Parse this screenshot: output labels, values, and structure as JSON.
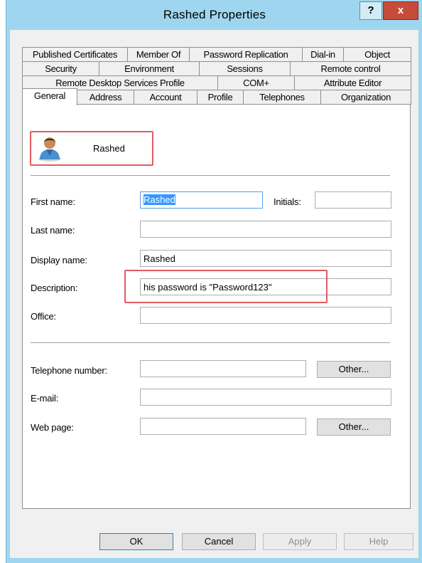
{
  "window": {
    "title": "Rashed Properties",
    "help_label": "?",
    "close_label": "x"
  },
  "tabs": {
    "row1": [
      "Published Certificates",
      "Member Of",
      "Password Replication",
      "Dial-in",
      "Object"
    ],
    "row2": [
      "Security",
      "Environment",
      "Sessions",
      "Remote control"
    ],
    "row3": [
      "Remote Desktop Services Profile",
      "COM+",
      "Attribute Editor"
    ],
    "row4": [
      "General",
      "Address",
      "Account",
      "Profile",
      "Telephones",
      "Organization"
    ],
    "active": "General"
  },
  "user": {
    "name": "Rashed"
  },
  "form": {
    "first_name": {
      "label": "First name:",
      "value": "Rashed"
    },
    "initials": {
      "label": "Initials:",
      "value": ""
    },
    "last_name": {
      "label": "Last name:",
      "value": ""
    },
    "display_name": {
      "label": "Display name:",
      "value": "Rashed"
    },
    "description": {
      "label": "Description:",
      "value": "his password is \"Password123\""
    },
    "office": {
      "label": "Office:",
      "value": ""
    },
    "telephone": {
      "label": "Telephone number:",
      "value": "",
      "other_label": "Other..."
    },
    "email": {
      "label": "E-mail:",
      "value": ""
    },
    "web_page": {
      "label": "Web page:",
      "value": "",
      "other_label": "Other..."
    }
  },
  "buttons": {
    "ok": "OK",
    "cancel": "Cancel",
    "apply": "Apply",
    "help": "Help"
  },
  "colors": {
    "title_bar": "#9fd6ef",
    "close_button": "#c74b3a",
    "highlight": "#e25b61",
    "selection": "#3399ff"
  }
}
